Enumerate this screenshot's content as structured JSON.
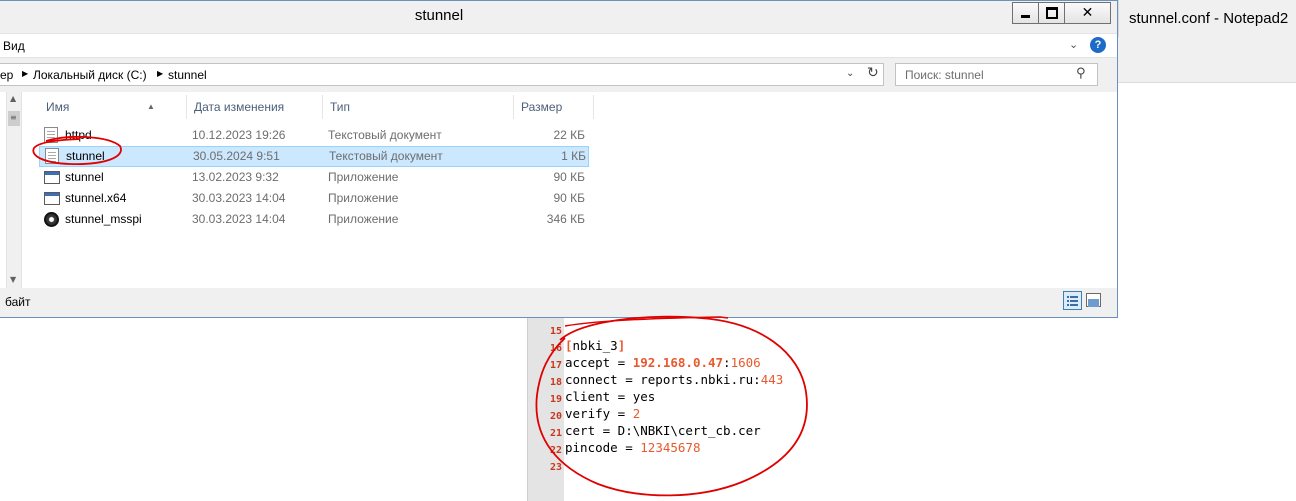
{
  "notepad": {
    "title": "stunnel.conf - Notepad2"
  },
  "window": {
    "title": "stunnel",
    "controls": {
      "minimize": "minimize",
      "maximize": "maximize",
      "close": "✕"
    }
  },
  "ribbon": {
    "view_tab": "Вид",
    "help": "?"
  },
  "address": {
    "crumbs": [
      "ер",
      "Локальный диск (C:)",
      "stunnel"
    ]
  },
  "search": {
    "placeholder": "Поиск: stunnel"
  },
  "columns": {
    "name": "Имя",
    "date": "Дата изменения",
    "type": "Тип",
    "size": "Размер"
  },
  "files": [
    {
      "name": "httpd",
      "date": "10.12.2023 19:26",
      "type": "Текстовый документ",
      "size": "22 КБ",
      "icon": "text-file-icon",
      "selected": false
    },
    {
      "name": "stunnel",
      "date": "30.05.2024 9:51",
      "type": "Текстовый документ",
      "size": "1 КБ",
      "icon": "text-file-icon",
      "selected": true
    },
    {
      "name": "stunnel",
      "date": "13.02.2023 9:32",
      "type": "Приложение",
      "size": "90 КБ",
      "icon": "application-icon",
      "selected": false
    },
    {
      "name": "stunnel.x64",
      "date": "30.03.2023 14:04",
      "type": "Приложение",
      "size": "90 КБ",
      "icon": "application-icon",
      "selected": false
    },
    {
      "name": "stunnel_msspi",
      "date": "30.03.2023 14:04",
      "type": "Приложение",
      "size": "346 КБ",
      "icon": "disc-app-icon",
      "selected": false
    }
  ],
  "status": {
    "text": "байт"
  },
  "code": {
    "line_numbers": [
      "15",
      "16",
      "17",
      "18",
      "19",
      "20",
      "21",
      "22",
      "23"
    ],
    "l16": {
      "open": "[",
      "name": "nbki_3",
      "close": "]"
    },
    "l17": {
      "key": "accept = ",
      "ip": "192.168.0.47",
      "sep": ":",
      "port": "1606"
    },
    "l18": {
      "key": "connect = reports.nbki.ru",
      "sep": ":",
      "port": "443"
    },
    "l19": {
      "text": "client = yes"
    },
    "l20": {
      "key": "verify = ",
      "value": "2"
    },
    "l21": {
      "text": "cert = D:\\NBKI\\cert_cb.cer"
    },
    "l22": {
      "key": "pincode = ",
      "value": "12345678"
    }
  },
  "colors": {
    "selection": "#cce8ff",
    "selection_border": "#99d1ff",
    "annotation": "#e00000",
    "code_accent": "#e8592e",
    "line_number": "#c8381e"
  }
}
